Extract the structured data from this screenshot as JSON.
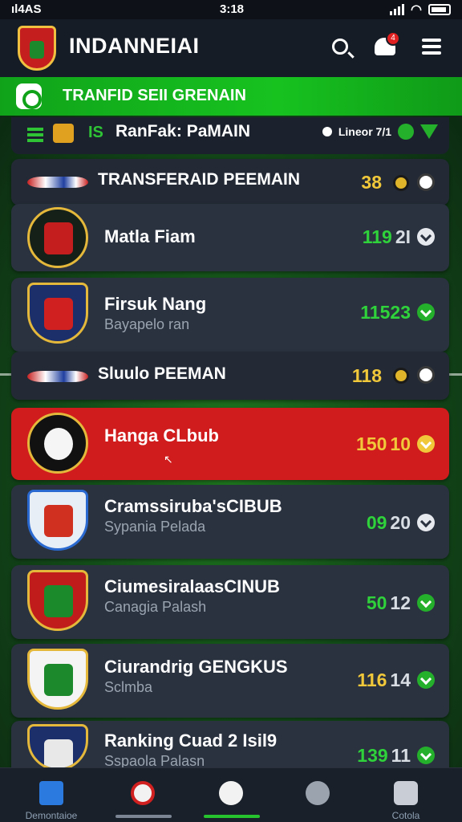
{
  "status_bar": {
    "carrier": "ıl4AS",
    "time": "3:18"
  },
  "header": {
    "title": "INDANNEIAI",
    "notification_count": "4"
  },
  "banner": {
    "text": "TRANFID SEII GRENAIN"
  },
  "filter": {
    "number": "IS",
    "label": "RanFak: PaMAIN",
    "right_text": "Lineor 7/1"
  },
  "rows": [
    {
      "type": "section",
      "name": "TRANSFERAID PEEMAIN",
      "score_a": "38",
      "score_b": ""
    },
    {
      "type": "club",
      "name": "Matla Fiam",
      "sub": "",
      "score_a": "119",
      "score_b": "2I"
    },
    {
      "type": "club",
      "name": "Firsuk Nang",
      "sub": "Bayapelo ran",
      "score_a": "11523",
      "score_b": ""
    },
    {
      "type": "section",
      "name": "Sluulo PEEMAN",
      "score_a": "118",
      "score_b": ""
    },
    {
      "type": "highlight",
      "name": "Hanga CLbub",
      "sub": "",
      "score_a": "150",
      "score_b": "10"
    },
    {
      "type": "club",
      "name": "Cramssiruba'sCIBUB",
      "sub": "Sypania Pelada",
      "score_a": "09",
      "score_b": "20"
    },
    {
      "type": "club",
      "name": "CiumesiralaasCINUB",
      "sub": "Canagia Palash",
      "score_a": "50",
      "score_b": "12"
    },
    {
      "type": "club",
      "name": "Ciurandrig GENGKUS",
      "sub": "Sclmba",
      "score_a": "116",
      "score_b": "14"
    },
    {
      "type": "club",
      "name": "Ranking Cuad 2 Isil9",
      "sub": "Sspaola Palasn",
      "score_a": "139",
      "score_b": "11"
    }
  ],
  "bottom_nav": [
    {
      "label": "Demontaioe",
      "icon": "home-icon"
    },
    {
      "label": "",
      "icon": "stats-icon"
    },
    {
      "label": "",
      "icon": "transfer-icon"
    },
    {
      "label": "",
      "icon": "ball-icon"
    },
    {
      "label": "Cotola",
      "icon": "players-icon"
    }
  ],
  "colors": {
    "accent_green": "#17c21f",
    "highlight_red": "#d01c1c",
    "gold": "#f0c83a"
  }
}
